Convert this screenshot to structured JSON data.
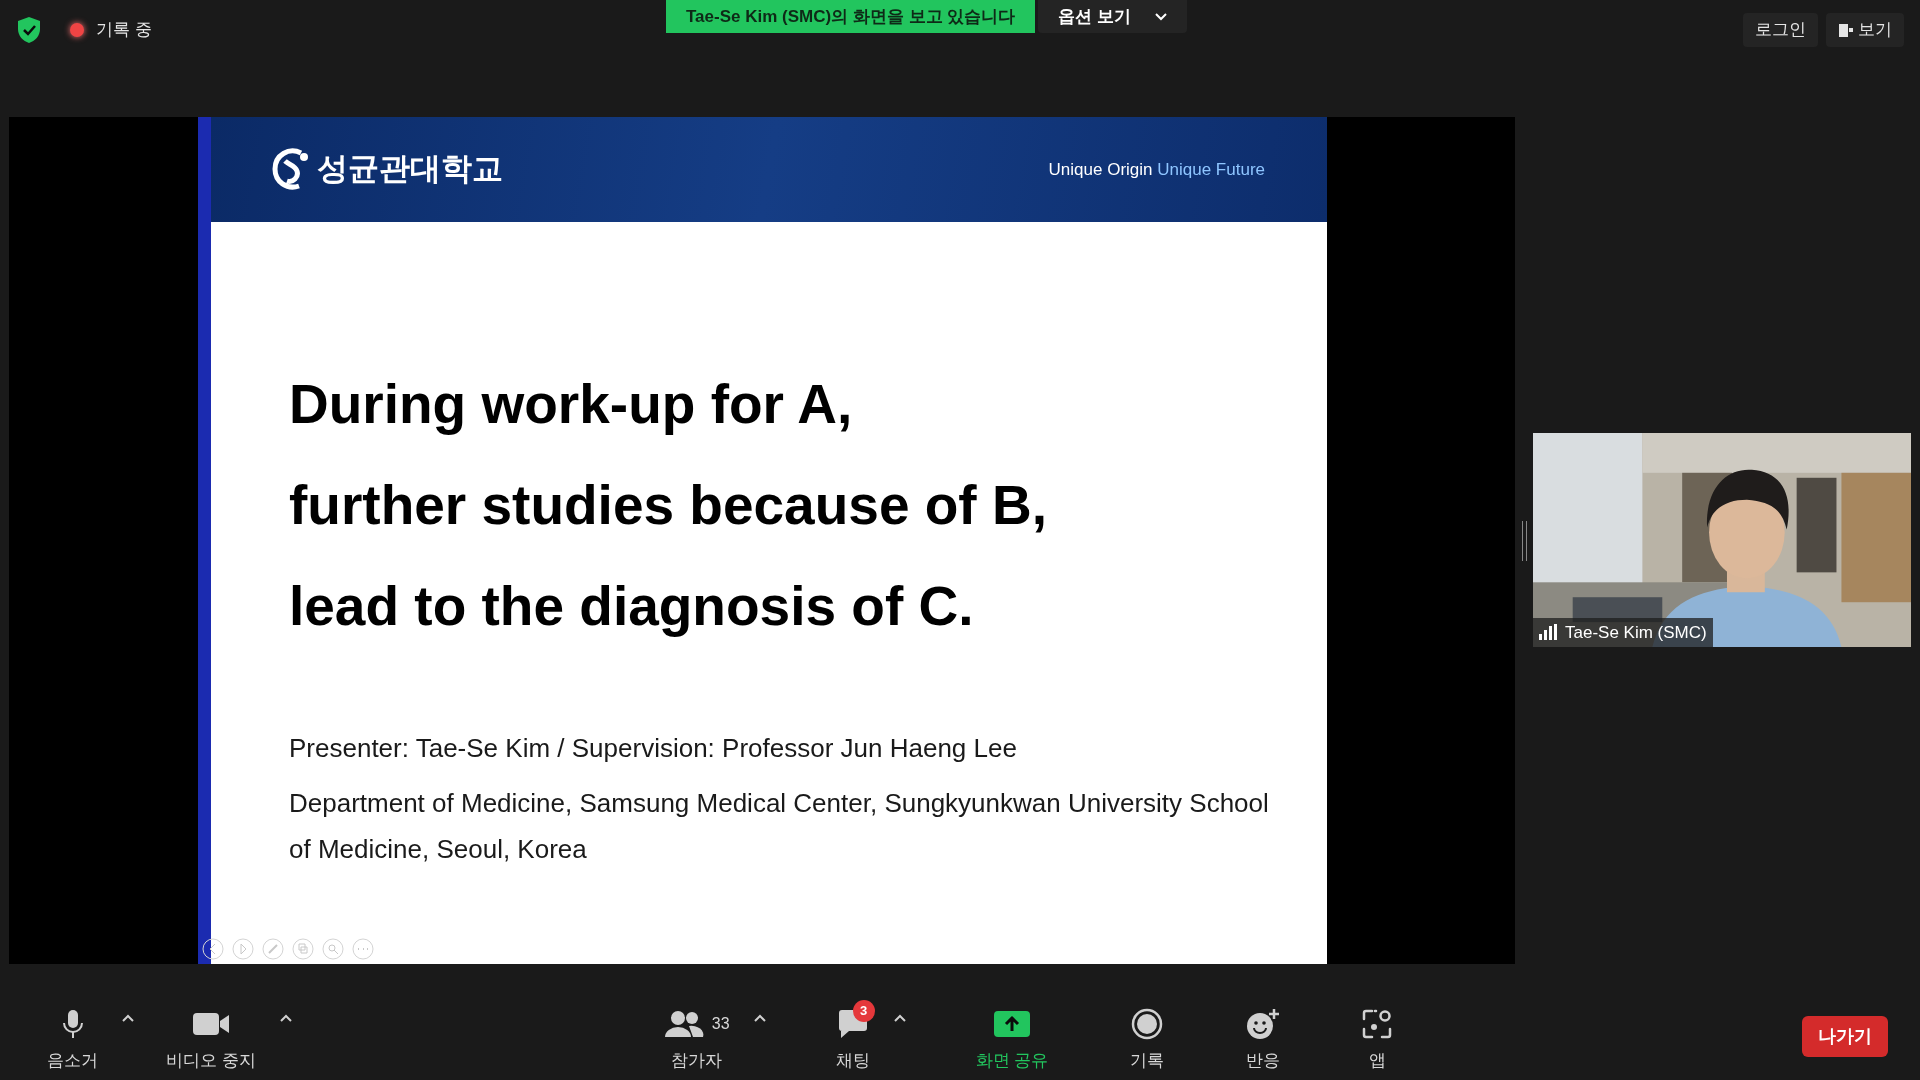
{
  "top_bar": {
    "recording": {
      "label": "기록 중",
      "on": true
    },
    "share_banner": "Tae-Se Kim (SMC)의 화면을 보고 있습니다",
    "view_options": "옵션 보기",
    "login": "로그인",
    "view": "보기"
  },
  "slide": {
    "brand": "성균관대학교",
    "slogan_1": "Unique Origin",
    "slogan_2": "Unique Future",
    "title_lines": [
      "During work-up for A,",
      "further studies because of B,",
      "lead to the diagnosis of C."
    ],
    "presenter": "Presenter: Tae-Se Kim / Supervision: Professor Jun Haeng Lee",
    "affiliation": "Department of Medicine, Samsung Medical Center, Sungkyunkwan University School of Medicine, Seoul, Korea"
  },
  "video": {
    "name": "Tae-Se Kim (SMC)"
  },
  "toolbar": {
    "left_items": [
      {
        "kind": "mic",
        "label": "음소거",
        "caret": true,
        "active": false
      },
      {
        "kind": "camera",
        "label": "비디오 중지",
        "caret": true,
        "active": false
      }
    ],
    "center_items": [
      {
        "kind": "participants",
        "label": "참가자",
        "count": "33",
        "caret": true,
        "active": false
      },
      {
        "kind": "chat",
        "label": "채팅",
        "badge": "3",
        "caret": true,
        "active": false
      },
      {
        "kind": "share",
        "label": "화면 공유",
        "caret": false,
        "active": true
      },
      {
        "kind": "record",
        "label": "기록",
        "caret": false,
        "active": false
      },
      {
        "kind": "reaction",
        "label": "반응",
        "caret": false,
        "active": false
      },
      {
        "kind": "apps",
        "label": "앱",
        "caret": false,
        "active": false
      }
    ],
    "leave": "나가기"
  }
}
